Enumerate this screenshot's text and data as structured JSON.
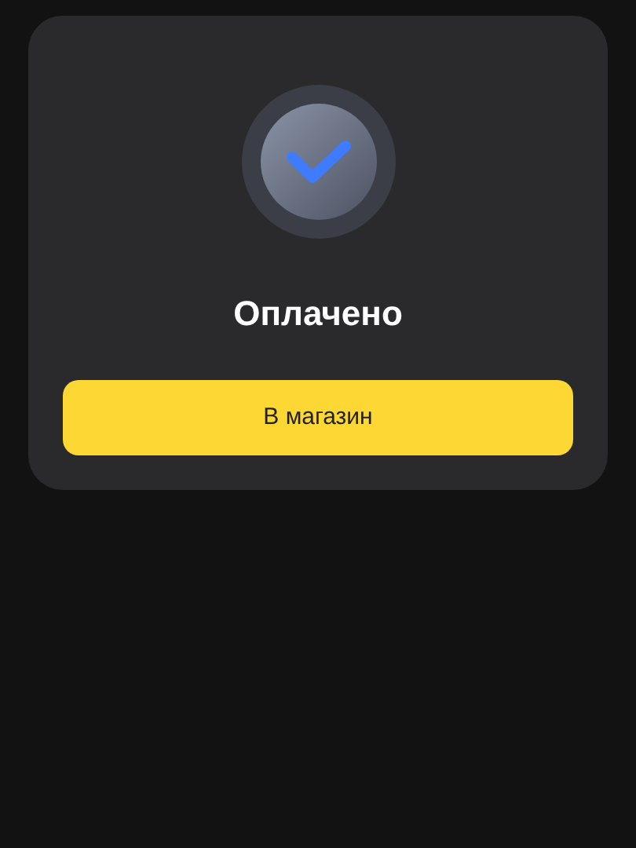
{
  "status": {
    "title": "Оплачено",
    "button": "В магазин"
  }
}
